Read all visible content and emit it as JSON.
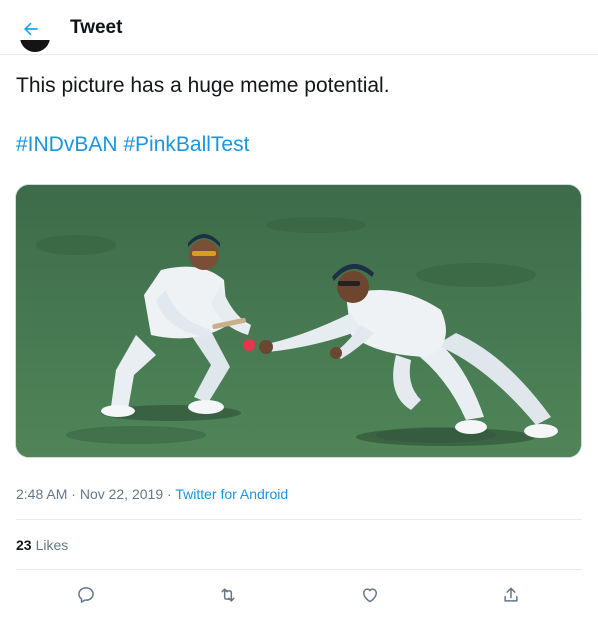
{
  "header": {
    "title": "Tweet"
  },
  "tweet": {
    "text": "This picture has a huge meme potential.",
    "hashtags": [
      "#INDvBAN",
      "#PinkBallTest"
    ],
    "time": "2:48 AM",
    "date": "Nov 22, 2019",
    "source": "Twitter for Android",
    "likes_count": "23",
    "likes_label": "Likes"
  },
  "colors": {
    "link": "#1b95e0",
    "muted": "#657786",
    "field": "#3f6e4b"
  },
  "icons": {
    "back": "arrow-left-icon",
    "reply": "reply-icon",
    "retweet": "retweet-icon",
    "like": "heart-icon",
    "share": "share-icon"
  }
}
